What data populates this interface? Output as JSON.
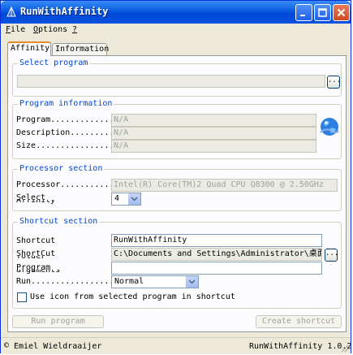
{
  "window": {
    "title": "RunWithAffinity"
  },
  "menu": [
    {
      "key": "F",
      "label": "ile"
    },
    {
      "key": "O",
      "label": "ptions"
    },
    {
      "key": "?",
      "label": ""
    }
  ],
  "tabs": [
    {
      "label": "Affinity",
      "active": true
    },
    {
      "label": "Information",
      "active": false
    }
  ],
  "select_program": {
    "title": "Select program",
    "path_value": "",
    "browse_label": "..."
  },
  "program_information": {
    "title": "Program information",
    "fields": [
      {
        "label": "Program..............",
        "value": "N/A"
      },
      {
        "label": "Description..........",
        "value": "N/A"
      },
      {
        "label": "Size.................",
        "value": "N/A"
      }
    ],
    "icon": "globe-icon"
  },
  "processor_section": {
    "title": "Processor section",
    "processor_label": "Processor...........",
    "processor_value": "Intel(R) Core(TM)2 Quad CPU Q8300 @ 2.50GHz",
    "select_label": "Select",
    "select_label_cut": "Affinity",
    "select_value": "4"
  },
  "shortcut_section": {
    "title": "Shortcut section",
    "shortcut_label": "Shortcut",
    "shortcut_value": "RunWithAffinity",
    "folder_label": "ShortCut",
    "folder_label_cut": "folder",
    "folder_value": "C:\\Documents and Settings\\Administrator\\桌面",
    "browse_label": "...",
    "args_label": "Program",
    "args_label_cut": "arguments",
    "args_value": "",
    "run_label": "Run..................",
    "run_value": "Normal",
    "checkbox_label": "Use icon from selected program in shortcut"
  },
  "buttons": {
    "run": "Run program",
    "create": "Create shortcut"
  },
  "status": {
    "author": "Emiel Wieldraaijer",
    "version": "RunWithAffinity 1.0.2"
  }
}
